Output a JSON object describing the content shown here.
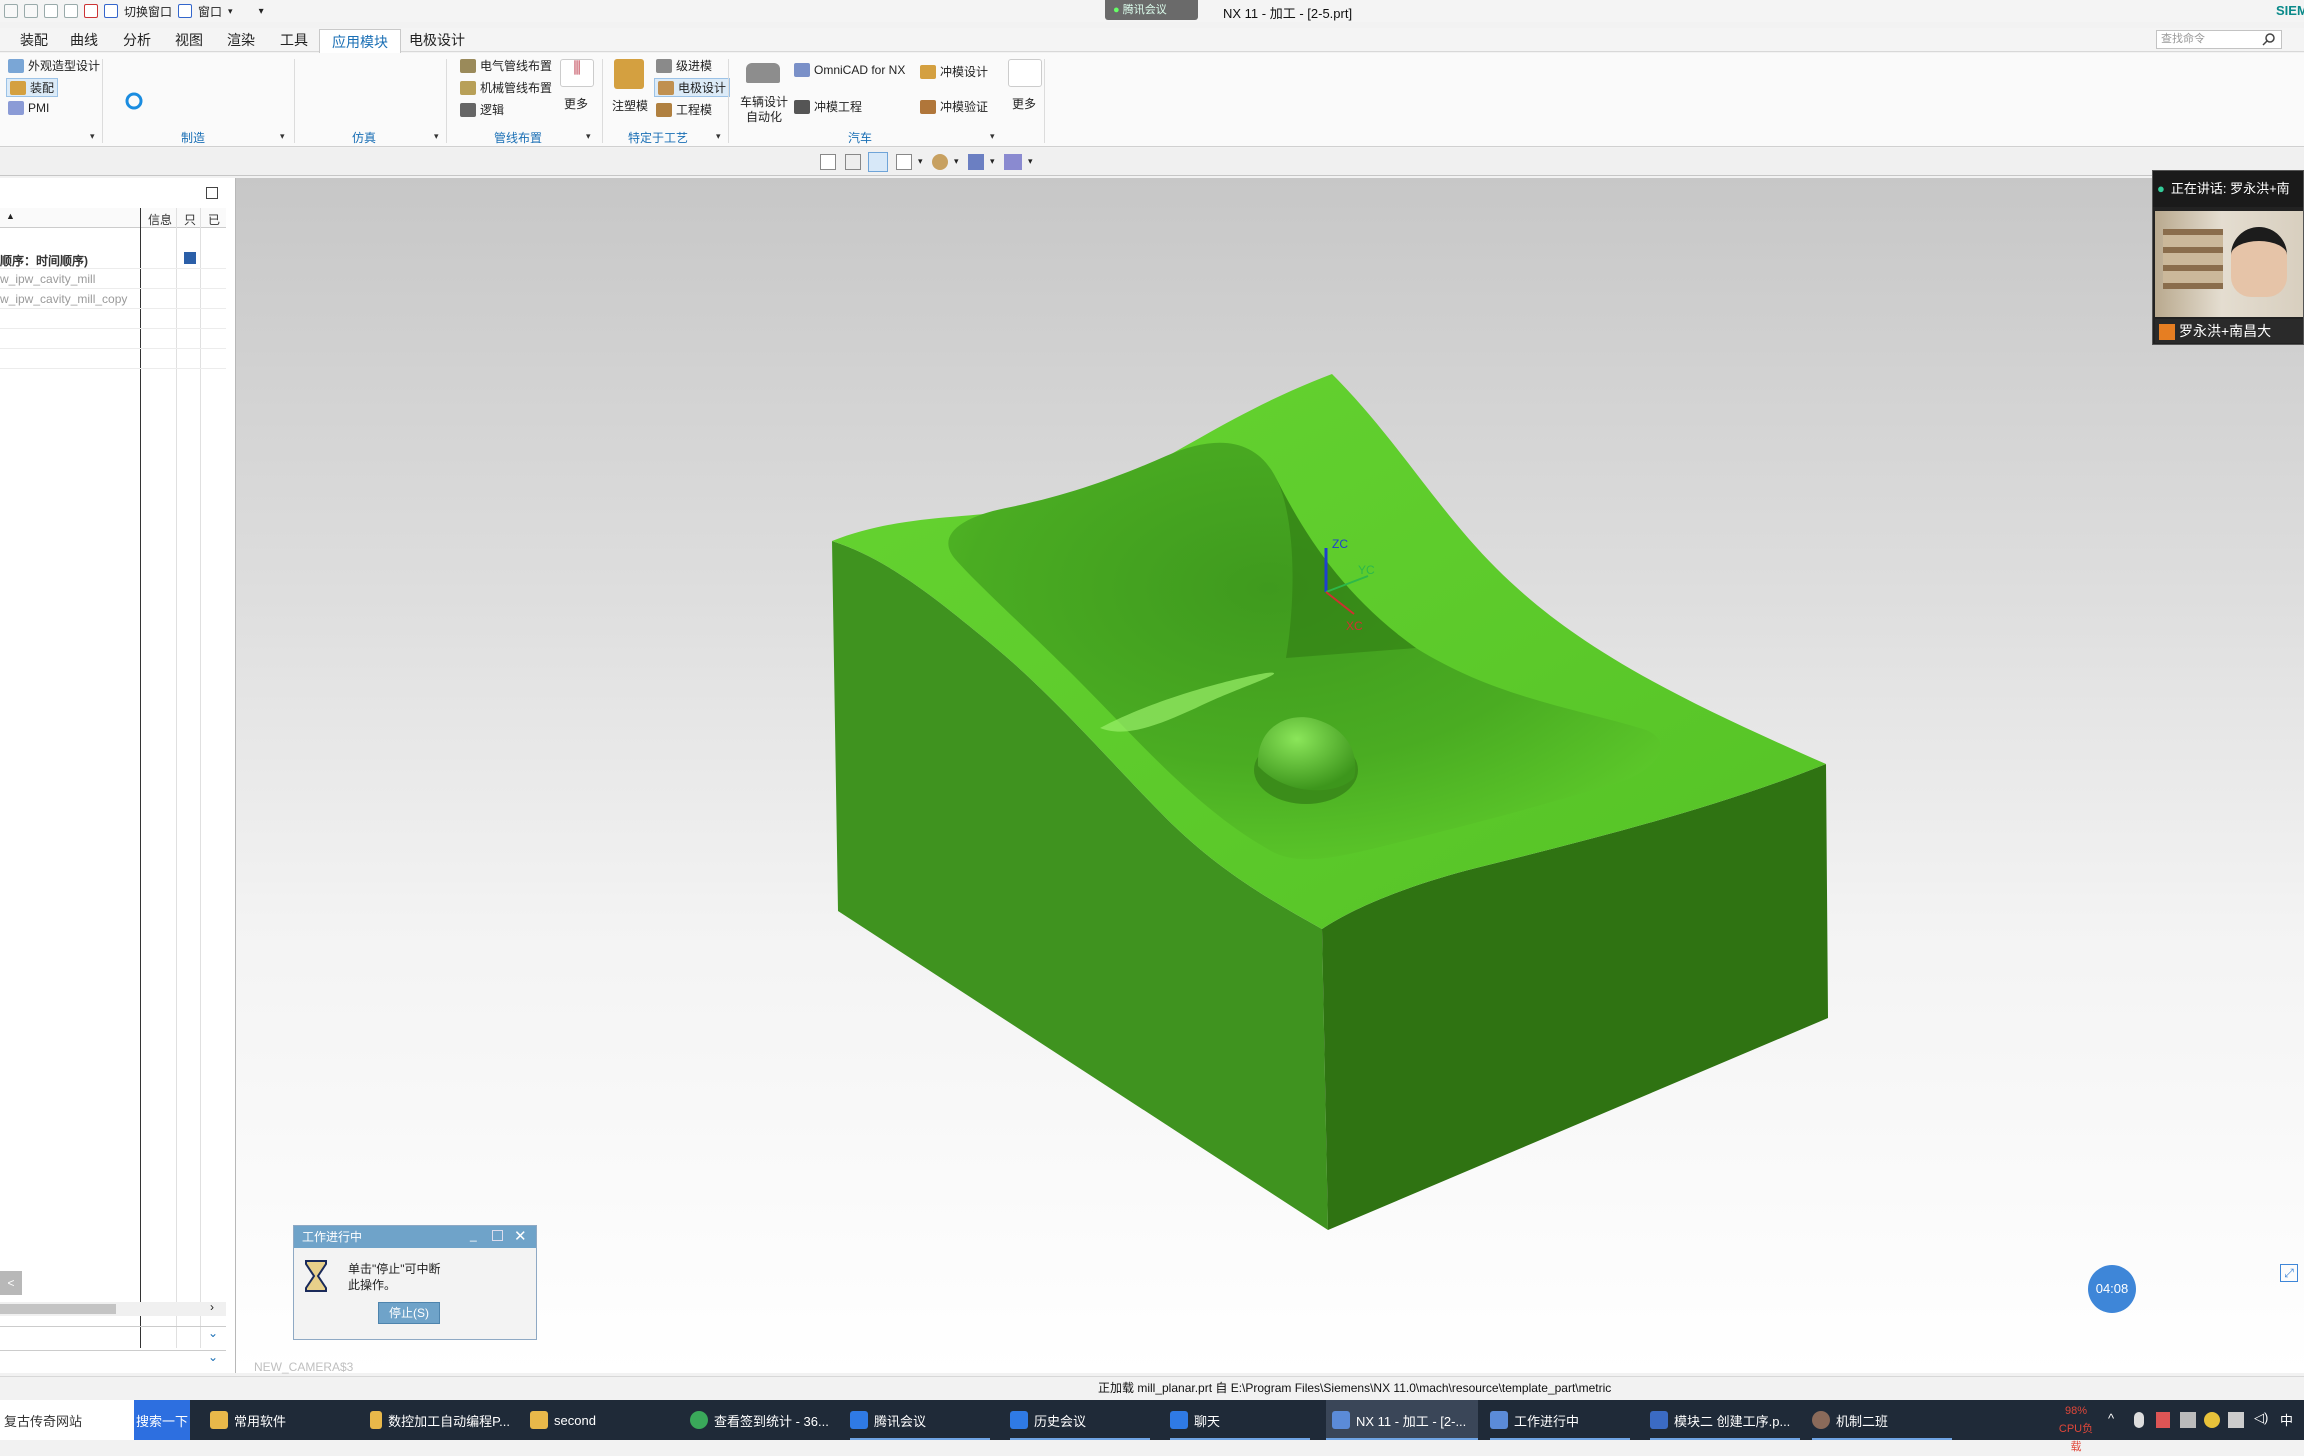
{
  "window": {
    "title": "NX 11 - 加工 - [2-5.prt]",
    "brand": "SIEMENS",
    "meeting_pill": "腾讯会议"
  },
  "quick_access": {
    "switch_window": "切换窗口",
    "window_menu": "窗口"
  },
  "menu": {
    "tabs": [
      "装配",
      "曲线",
      "分析",
      "视图",
      "渲染",
      "工具",
      "应用模块",
      "电极设计"
    ],
    "active": "应用模块"
  },
  "search": {
    "placeholder": "查找命令"
  },
  "ribbon": {
    "design": {
      "items": [
        "外观造型设计",
        "装配",
        "PMI"
      ]
    },
    "groups": [
      "制造",
      "仿真",
      "管线布置",
      "特定于工艺",
      "汽车"
    ],
    "routing": {
      "items": [
        "电气管线布置",
        "机械管线布置",
        "逻辑"
      ],
      "more": "更多"
    },
    "process": {
      "injection": "注塑模",
      "items": [
        "级进模",
        "电极设计",
        "工程模"
      ]
    },
    "auto": {
      "vehicle": "车辆设计自动化",
      "omnicad": "OmniCAD for NX",
      "stamping": "冲模工程",
      "die_design": "冲模设计",
      "die_verify": "冲模验证",
      "more": "更多"
    }
  },
  "navigator": {
    "columns": {
      "info": "信息",
      "c2": "只",
      "c3": "已"
    },
    "root": "顺序：时间顺序)",
    "rows": [
      "w_ipw_cavity_mill",
      "w_ipw_cavity_mill_copy"
    ]
  },
  "triad": {
    "zc": "ZC",
    "yc": "YC",
    "xc": "XC"
  },
  "camera_label": "NEW_CAMERA$3",
  "status": {
    "text": "正加载 mill_planar.prt 自 E:\\Program Files\\Siemens\\NX 11.0\\mach\\resource\\template_part\\metric"
  },
  "progress_dialog": {
    "title": "工作进行中",
    "line1": "单击\"停止\"可中断",
    "line2": "此操作。",
    "stop": "停止(S)"
  },
  "webcam": {
    "speaking": "正在讲话: 罗永洪+南",
    "name": "罗永洪+南昌大"
  },
  "timer": "04:08",
  "taskbar": {
    "items": [
      "复古传奇网站",
      "搜索一下",
      "常用软件",
      "数控加工自动编程P...",
      "second",
      "查看签到统计 - 36...",
      "腾讯会议",
      "历史会议",
      "聊天",
      "NX 11 - 加工 - [2-...",
      "工作进行中",
      "模块二 创建工序.p...",
      "机制二班"
    ],
    "cpu_percent": "98%",
    "cpu_label": "CPU负载",
    "ime": "中"
  },
  "colors": {
    "accent": "#1a6fb5",
    "model_top": "#5cc82a",
    "model_side": "#3b8d1d",
    "taskbar": "#1f2a38"
  }
}
